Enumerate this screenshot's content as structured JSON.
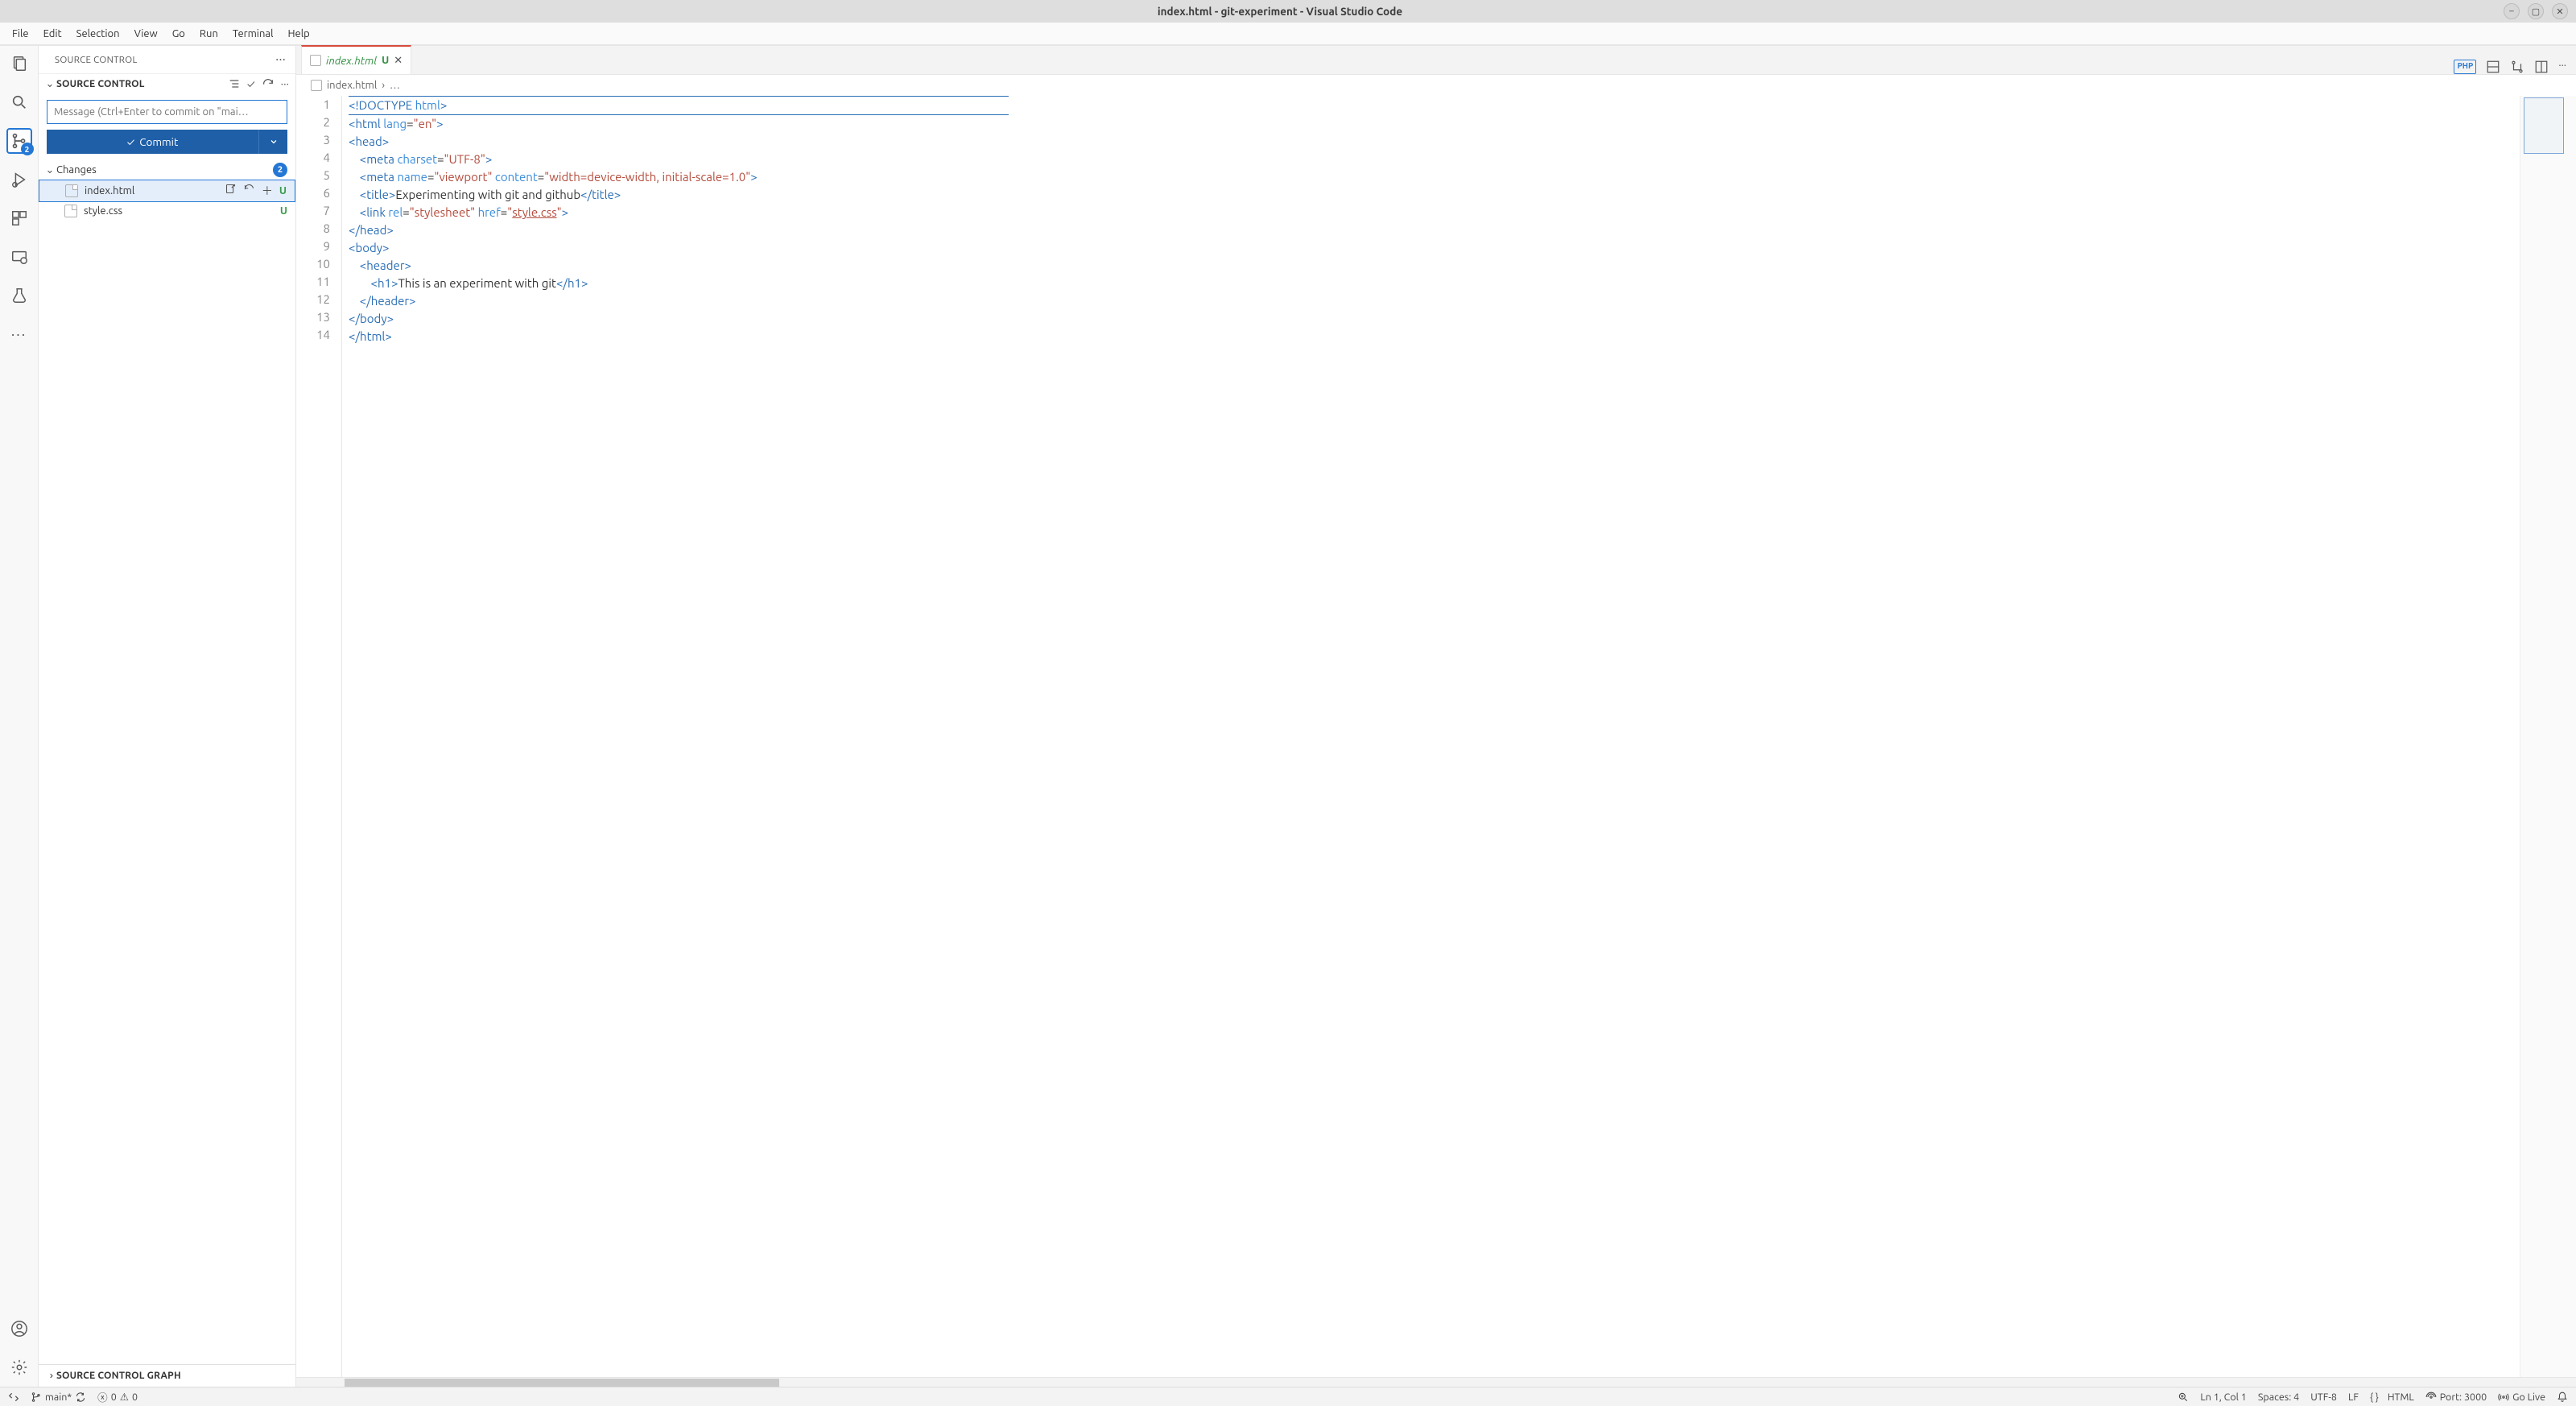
{
  "title_bar": {
    "title": "index.html - git-experiment - Visual Studio Code"
  },
  "menu": {
    "items": [
      "File",
      "Edit",
      "Selection",
      "View",
      "Go",
      "Run",
      "Terminal",
      "Help"
    ]
  },
  "activity_bar": {
    "scm_badge": "2"
  },
  "sidebar": {
    "header": "SOURCE CONTROL",
    "repo_header": "SOURCE CONTROL",
    "commit_placeholder": "Message (Ctrl+Enter to commit on \"mai…",
    "commit_button": "Commit",
    "changes_label": "Changes",
    "changes_count": "2",
    "files": [
      {
        "name": "index.html",
        "status": "U",
        "selected": true,
        "show_actions": true
      },
      {
        "name": "style.css",
        "status": "U",
        "selected": false,
        "show_actions": false
      }
    ],
    "graph_header": "SOURCE CONTROL GRAPH"
  },
  "tabs": {
    "active": {
      "name": "index.html",
      "status": "U"
    }
  },
  "breadcrumb": {
    "file": "index.html",
    "rest": "…"
  },
  "code_lines": [
    {
      "n": 1,
      "html": "<span class='tag'>&lt;!DOCTYPE</span> <span class='attr'>html</span><span class='tag'>&gt;</span>"
    },
    {
      "n": 2,
      "html": "<span class='tag'>&lt;html</span> <span class='attr'>lang</span>=<span class='str'>\"en\"</span><span class='tag'>&gt;</span>"
    },
    {
      "n": 3,
      "html": "<span class='tag'>&lt;head&gt;</span>"
    },
    {
      "n": 4,
      "html": "    <span class='tag'>&lt;meta</span> <span class='attr'>charset</span>=<span class='str'>\"UTF-8\"</span><span class='tag'>&gt;</span>"
    },
    {
      "n": 5,
      "html": "    <span class='tag'>&lt;meta</span> <span class='attr'>name</span>=<span class='str'>\"viewport\"</span> <span class='attr'>content</span>=<span class='str'>\"width=device-width, initial-scale=1.0\"</span><span class='tag'>&gt;</span>"
    },
    {
      "n": 6,
      "html": "    <span class='tag'>&lt;title&gt;</span><span class='txt'>Experimenting with git and github</span><span class='tag'>&lt;/title&gt;</span>"
    },
    {
      "n": 7,
      "html": "    <span class='tag'>&lt;link</span> <span class='attr'>rel</span>=<span class='str'>\"stylesheet\"</span> <span class='attr'>href</span>=<span class='str'>\"<span class='link'>style.css</span>\"</span><span class='tag'>&gt;</span>"
    },
    {
      "n": 8,
      "html": "<span class='tag'>&lt;/head&gt;</span>"
    },
    {
      "n": 9,
      "html": "<span class='tag'>&lt;body&gt;</span>"
    },
    {
      "n": 10,
      "html": "    <span class='tag'>&lt;header&gt;</span>"
    },
    {
      "n": 11,
      "html": "        <span class='tag'>&lt;h1&gt;</span><span class='txt'>This is an experiment with git</span><span class='tag'>&lt;/h1&gt;</span>"
    },
    {
      "n": 12,
      "html": "    <span class='tag'>&lt;/header&gt;</span>"
    },
    {
      "n": 13,
      "html": "<span class='tag'>&lt;/body&gt;</span>"
    },
    {
      "n": 14,
      "html": "<span class='tag'>&lt;/html&gt;</span>"
    }
  ],
  "status_bar": {
    "branch": "main*",
    "errors": "0",
    "warnings": "0",
    "cursor": "Ln 1, Col 1",
    "spaces": "Spaces: 4",
    "encoding": "UTF-8",
    "eol": "LF",
    "lang": "HTML",
    "port": "Port: 3000",
    "golive": "Go Live"
  },
  "editor_actions": {
    "php_label": "PHP"
  }
}
